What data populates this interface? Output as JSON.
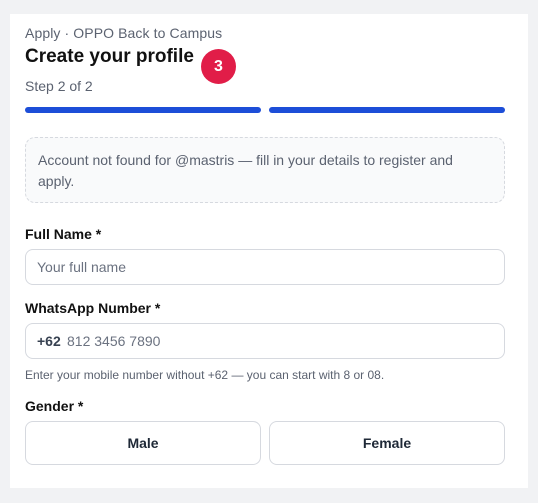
{
  "header": {
    "breadcrumb": "Apply · OPPO Back to Campus",
    "title": "Create your profile",
    "badge": "3",
    "step": "Step 2 of 2"
  },
  "progress": {
    "current_step": 2,
    "total_steps": 2
  },
  "notice": {
    "text": "Account not found for @mastris — fill in your details to register and apply."
  },
  "form": {
    "full_name": {
      "label": "Full Name *",
      "placeholder": "Your full name",
      "value": ""
    },
    "whatsapp": {
      "label": "WhatsApp Number *",
      "prefix": "+62",
      "placeholder": "812 3456 7890",
      "value": "",
      "hint": "Enter your mobile number without +62 — you can start with 8 or 08."
    },
    "gender": {
      "label": "Gender *",
      "options": [
        "Male",
        "Female"
      ]
    }
  },
  "colors": {
    "accent": "#1d4ed8",
    "badge": "#e11d48"
  }
}
